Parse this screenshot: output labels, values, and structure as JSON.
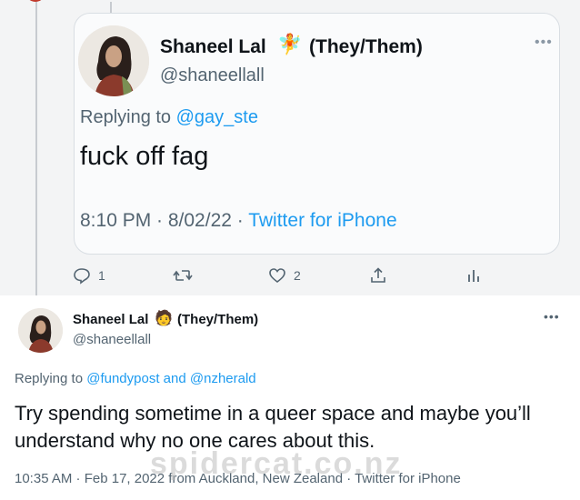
{
  "quoted_tweet": {
    "author_name": "Shaneel Lal",
    "author_emoji": "🧚",
    "author_pronouns": "(They/Them)",
    "author_handle": "@shaneellall",
    "more_icon": "more-horizontal-icon",
    "replying_prefix": "Replying to",
    "replying_to": "@gay_ste",
    "text": "fuck off fag",
    "time": "8:10 PM · 8/02/22 · ",
    "client": "Twitter for iPhone"
  },
  "actions": {
    "reply_count": "1",
    "retweet_count": "",
    "like_count": "2"
  },
  "main_tweet": {
    "author_name": "Shaneel Lal",
    "author_emoji": "🧑",
    "author_pronouns": "(They/Them)",
    "author_handle": "@shaneellall",
    "replying_prefix": "Replying to",
    "replying_to_1": "@fundypost",
    "replying_and": "and",
    "replying_to_2": "@nzherald",
    "text": "Try spending sometime in a queer space and maybe you’ll understand why no one cares about this.",
    "meta": "10:35 AM · Feb 17, 2022 from Auckland, New Zealand · Twitter for iPhone"
  },
  "watermark": "spidercat.co.nz"
}
